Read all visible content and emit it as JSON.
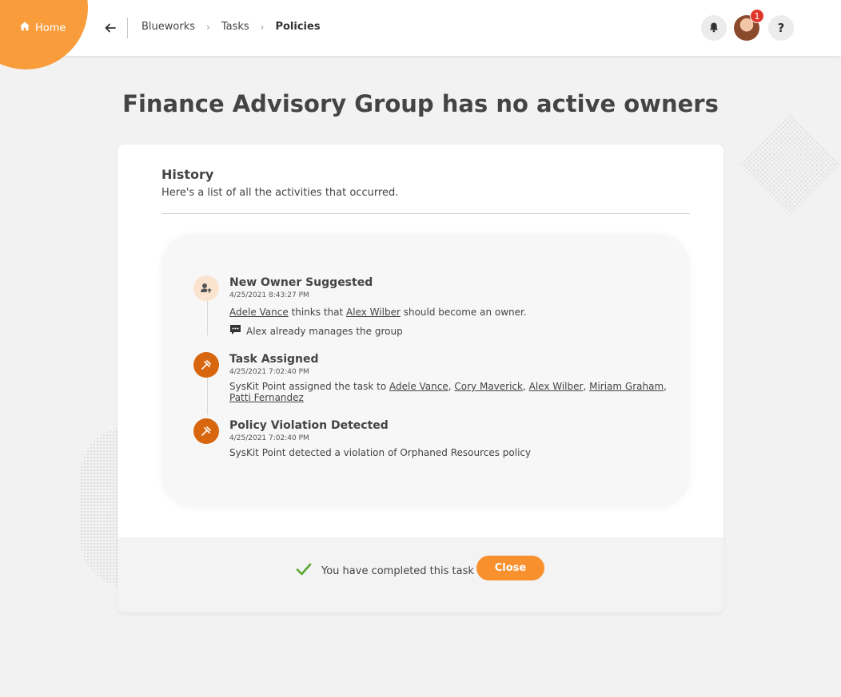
{
  "header": {
    "home_label": "Home",
    "breadcrumbs": [
      "Blueworks",
      "Tasks",
      "Policies"
    ],
    "notification_count": "1",
    "help_label": "?"
  },
  "page": {
    "title": "Finance Advisory Group has no active owners"
  },
  "history": {
    "title": "History",
    "subtitle": "Here's a list of all the activities that occurred.",
    "events": [
      {
        "title": "New Owner Suggested",
        "time": "4/25/2021 8:43:27 PM",
        "actor": "Adele Vance",
        "text_mid": "thinks that",
        "target": "Alex Wilber",
        "text_end": "should become an owner.",
        "comment": "Alex already manages the group",
        "icon": "user-suggest-icon"
      },
      {
        "title": "Task Assigned",
        "time": "4/25/2021 7:02:40 PM",
        "text_start": "SysKit Point assigned the task to",
        "assignees": [
          "Adele Vance",
          "Cory Maverick",
          "Alex Wilber",
          "Miriam Graham",
          "Patti Fernandez"
        ],
        "icon": "tools-icon"
      },
      {
        "title": "Policy Violation Detected",
        "time": "4/25/2021 7:02:40 PM",
        "text": "SysKit Point detected a violation of Orphaned Resources policy",
        "icon": "tools-icon"
      }
    ]
  },
  "footer": {
    "status_text": "You have completed this task",
    "close_label": "Close"
  },
  "colors": {
    "accent": "#f99d3c",
    "button": "#f7902d",
    "event_icon_dark": "#d7660f",
    "event_icon_light": "#fbe4cf",
    "check": "#5aa832",
    "badge": "#e0352b"
  }
}
